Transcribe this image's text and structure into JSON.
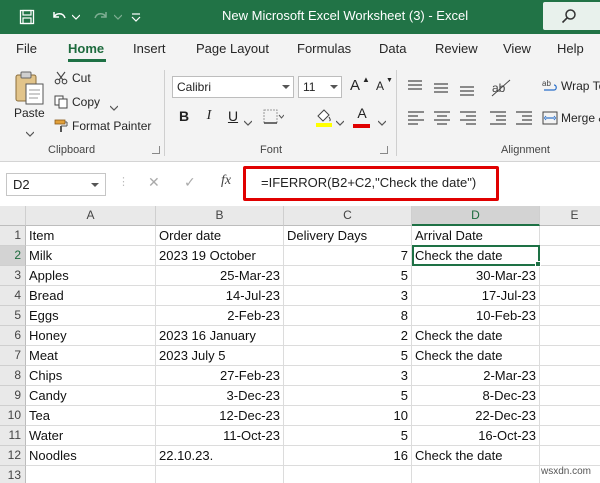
{
  "title_bar": {
    "title": "New Microsoft Excel Worksheet (3)  -  Excel",
    "accent_color": "#217346",
    "icons": [
      "save-icon",
      "undo-icon",
      "redo-icon",
      "customize-qat-icon",
      "search-icon"
    ]
  },
  "tabs": [
    "File",
    "Home",
    "Insert",
    "Page Layout",
    "Formulas",
    "Data",
    "Review",
    "View",
    "Help"
  ],
  "active_tab": "Home",
  "ribbon": {
    "clipboard": {
      "paste_label": "Paste",
      "cut_label": "Cut",
      "copy_label": "Copy",
      "format_painter_label": "Format Painter",
      "group_label": "Clipboard"
    },
    "font": {
      "font_name": "Calibri",
      "font_size": "11",
      "bold": "B",
      "italic": "I",
      "underline": "U",
      "font_color_glyph": "A",
      "grow_glyph": "A",
      "shrink_glyph": "A",
      "group_label": "Font",
      "highlight_color": "#ffff00",
      "font_color": "#e00000"
    },
    "alignment": {
      "wrap_text_label": "Wrap Te",
      "merge_label": "Merge &",
      "group_label": "Alignment"
    }
  },
  "formula_bar": {
    "name_box": "D2",
    "fx_label": "fx",
    "formula": "=IFERROR(B2+C2,\"Check the date\")",
    "highlight_color": "#e00000"
  },
  "sheet": {
    "columns": [
      "A",
      "B",
      "C",
      "D",
      "E"
    ],
    "selected_column": "D",
    "selected_row": "2",
    "row_numbers": [
      "1",
      "2",
      "3",
      "4",
      "5",
      "6",
      "7",
      "8",
      "9",
      "10",
      "11",
      "12",
      "13"
    ],
    "header_row": [
      "Item",
      "Order date",
      "Delivery Days",
      "Arrival Date"
    ],
    "rows": [
      [
        "Milk",
        "2023 19 October",
        "7",
        "Check the date"
      ],
      [
        "Apples",
        "25-Mar-23",
        "5",
        "30-Mar-23"
      ],
      [
        "Bread",
        "14-Jul-23",
        "3",
        "17-Jul-23"
      ],
      [
        "Eggs",
        "2-Feb-23",
        "8",
        "10-Feb-23"
      ],
      [
        "Honey",
        "2023 16 January",
        "2",
        "Check the date"
      ],
      [
        "Meat",
        "2023 July 5",
        "5",
        "Check the date"
      ],
      [
        "Chips",
        "27-Feb-23",
        "3",
        "2-Mar-23"
      ],
      [
        "Candy",
        "3-Dec-23",
        "5",
        "8-Dec-23"
      ],
      [
        "Tea",
        "12-Dec-23",
        "10",
        "22-Dec-23"
      ],
      [
        "Water",
        "11-Oct-23",
        "5",
        "16-Oct-23"
      ],
      [
        "Noodles",
        "22.10.23.",
        "16",
        "Check the date"
      ]
    ],
    "active_cell": "D2"
  },
  "watermark": "wsxdn.com"
}
